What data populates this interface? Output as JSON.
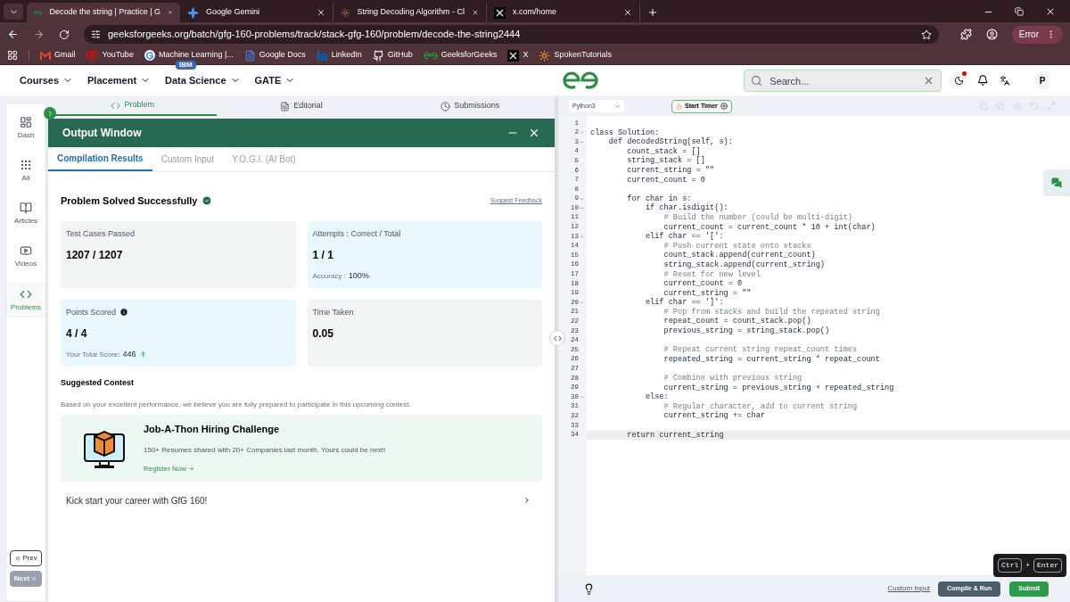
{
  "browser": {
    "tabs": [
      {
        "title": "Decode the string | Practice | G",
        "selected": true
      },
      {
        "title": "Google Gemini",
        "selected": false
      },
      {
        "title": "String Decoding Algorithm - Cl",
        "selected": false
      },
      {
        "title": "x.com/home",
        "selected": false
      }
    ],
    "url": "geeksforgeeks.org/batch/gfg-160-problems/track/stack-gfg-160/problem/decode-the-string2444",
    "profile": "Error",
    "bookmarks": [
      {
        "label": "Gmail"
      },
      {
        "label": "YouTube"
      },
      {
        "label": "Machine Learning |..."
      },
      {
        "label": "Google Docs"
      },
      {
        "label": "LinkedIn"
      },
      {
        "label": "GitHub"
      },
      {
        "label": "GeeksforGeeks"
      },
      {
        "label": "X"
      },
      {
        "label": "SpokenTutorials"
      }
    ]
  },
  "navbar": {
    "menus": [
      {
        "label": "Courses"
      },
      {
        "label": "Placement"
      },
      {
        "label": "Data Science",
        "badge": "IBM"
      },
      {
        "label": "GATE"
      }
    ],
    "search": {
      "placeholder": "Search..."
    },
    "avatar": "P"
  },
  "sidebar": {
    "items": [
      {
        "label": "Dash",
        "selected": false
      },
      {
        "label": "All",
        "selected": false
      },
      {
        "label": "Articles",
        "selected": false
      },
      {
        "label": "Videos",
        "selected": false
      },
      {
        "label": "Problems",
        "selected": true
      }
    ],
    "prev": {
      "label": "Prev",
      "disabled": false
    },
    "next": {
      "label": "Next",
      "disabled": true
    }
  },
  "problem_tabs": [
    {
      "label": "Problem",
      "selected": true
    },
    {
      "label": "Editorial",
      "selected": false
    },
    {
      "label": "Submissions",
      "selected": false
    }
  ],
  "output_window": {
    "title": "Output Window",
    "tabs": [
      {
        "label": "Compilation Results",
        "selected": true
      },
      {
        "label": "Custom Input",
        "selected": false
      },
      {
        "label": "Y.O.G.I. (AI Bot)",
        "selected": false
      }
    ],
    "status": "Problem Solved Successfully",
    "feedback": "Suggest Feedback",
    "cards": [
      {
        "label": "Test Cases Passed",
        "value": "1207 / 1207",
        "color": "#f1f5f4"
      },
      {
        "label": "Attempts : Correct / Total",
        "value": "1 / 1",
        "color": "#e8f8fc",
        "note_label": "Accuracy :",
        "note_value": "100%"
      },
      {
        "label": "Points Scored",
        "value": "4 / 4",
        "color": "#e8f8fc",
        "info": true,
        "note_label": "Your Total Score:",
        "note_value": "446",
        "trend_up": true
      },
      {
        "label": "Time Taken",
        "value": "0.05",
        "color": "#f1f5f4"
      }
    ],
    "contest": {
      "heading": "Suggested Contest",
      "text": "Based on your excellent performance, we believe you are fully prepared to participate in this upcoming contest.",
      "title": "Job-A-Thon Hiring Challenge",
      "description": "150+ Resumes shared with 20+ Companies last month. Yours could be next!",
      "link": "Register Now"
    },
    "banner": "Kick start your career with GfG 160!"
  },
  "editor": {
    "language": "Python3",
    "timer": "Start Timer",
    "lines": [
      {
        "n": "1",
        "fold": false
      },
      {
        "n": "2",
        "text": "class Solution:",
        "fold": true,
        "kind": "code"
      },
      {
        "n": "3",
        "text": "    def decodedString(self, s):",
        "fold": true,
        "kind": "code"
      },
      {
        "n": "4",
        "text": "        count_stack = []",
        "fold": false,
        "kind": "code"
      },
      {
        "n": "5",
        "text": "        string_stack = []",
        "fold": false,
        "kind": "code"
      },
      {
        "n": "6",
        "text": "        current_string = \"\"",
        "fold": false,
        "kind": "code"
      },
      {
        "n": "7",
        "text": "        current_count = 0",
        "fold": false,
        "kind": "code"
      },
      {
        "n": "8",
        "fold": false
      },
      {
        "n": "9",
        "text": "        for char in s:",
        "fold": true,
        "kind": "code"
      },
      {
        "n": "10",
        "text": "            if char.isdigit():",
        "fold": true,
        "kind": "code"
      },
      {
        "n": "11",
        "text": "                # Build the number (could be multi-digit)",
        "fold": false,
        "kind": "comment"
      },
      {
        "n": "12",
        "text": "                current_count = current_count * 10 + int(char)",
        "fold": false,
        "kind": "code"
      },
      {
        "n": "13",
        "text": "            elif char == '[':",
        "fold": true,
        "kind": "code"
      },
      {
        "n": "14",
        "text": "                # Push current state onto stacks",
        "fold": false,
        "kind": "comment"
      },
      {
        "n": "15",
        "text": "                count_stack.append(current_count)",
        "fold": false,
        "kind": "code"
      },
      {
        "n": "16",
        "text": "                string_stack.append(current_string)",
        "fold": false,
        "kind": "code"
      },
      {
        "n": "17",
        "text": "                # Reset for new level",
        "fold": false,
        "kind": "comment"
      },
      {
        "n": "18",
        "text": "                current_count = 0",
        "fold": false,
        "kind": "code"
      },
      {
        "n": "19",
        "text": "                current_string = \"\"",
        "fold": false,
        "kind": "code"
      },
      {
        "n": "20",
        "text": "            elif char == ']':",
        "fold": true,
        "kind": "code"
      },
      {
        "n": "21",
        "text": "                # Pop from stacks and build the repeated string",
        "fold": false,
        "kind": "comment"
      },
      {
        "n": "22",
        "text": "                repeat_count = count_stack.pop()",
        "fold": false,
        "kind": "code"
      },
      {
        "n": "23",
        "text": "                previous_string = string_stack.pop()",
        "fold": false,
        "kind": "code"
      },
      {
        "n": "24",
        "fold": false
      },
      {
        "n": "25",
        "text": "                # Repeat current string repeat_count times",
        "fold": false,
        "kind": "comment"
      },
      {
        "n": "26",
        "text": "                repeated_string = current_string * repeat_count",
        "fold": false,
        "kind": "code"
      },
      {
        "n": "27",
        "fold": false
      },
      {
        "n": "28",
        "text": "                # Combine with previous string",
        "fold": false,
        "kind": "comment"
      },
      {
        "n": "29",
        "text": "                current_string = previous_string + repeated_string",
        "fold": false,
        "kind": "code"
      },
      {
        "n": "30",
        "text": "            else:",
        "fold": true,
        "kind": "code"
      },
      {
        "n": "31",
        "text": "                # Regular character, add to current string",
        "fold": false,
        "kind": "comment"
      },
      {
        "n": "32",
        "text": "                current_string += char",
        "fold": false,
        "kind": "code"
      },
      {
        "n": "33",
        "fold": false
      },
      {
        "n": "34",
        "text": "        return current_string",
        "fold": false,
        "kind": "code"
      }
    ],
    "footer": {
      "custom_input": "Custom Input",
      "compile": "Compile & Run",
      "submit": "Submit",
      "shortcut": [
        "Ctrl",
        "+",
        "Enter"
      ]
    }
  }
}
